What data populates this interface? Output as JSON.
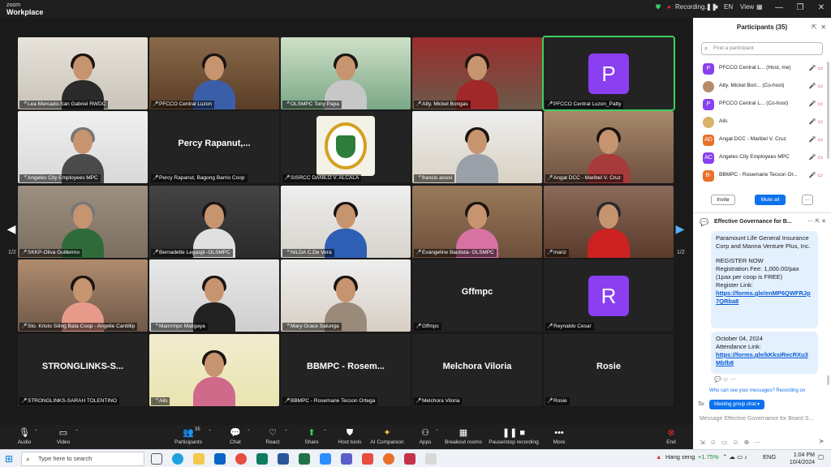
{
  "app": {
    "logo_line1": "zoom",
    "logo_line2": "Workplace",
    "recording_label": "Recording...",
    "language": "EN",
    "view_label": "View"
  },
  "video_grid": {
    "page_left": "1/2",
    "page_right": "1/2",
    "tiles": [
      {
        "name": "Lea Mercado-San Gabriel RWDC"
      },
      {
        "name": "PFCCO Central Luzon"
      },
      {
        "name": "OLSMPC Tony Papa"
      },
      {
        "name": "Atty. Mickel Bongas"
      },
      {
        "name": "PFCCO Central Luzon_Patty",
        "avatar": "P"
      },
      {
        "name": "Angeles City Employees MPC"
      },
      {
        "name": "Percy Rapanut, Bagong Barrio Coop",
        "big": "Percy Rapanut,..."
      },
      {
        "name": "SISRCC DANILO V. ALCALA"
      },
      {
        "name": "francis assisi"
      },
      {
        "name": "Angat DCC - Maribel V. Cruz"
      },
      {
        "name": "SKKP-Oliva Guillermo"
      },
      {
        "name": "Bernadette Legaspi -OLSMPC"
      },
      {
        "name": "NILDA C.De Vera"
      },
      {
        "name": "Evangeline Bautista- OLSMPC"
      },
      {
        "name": "mariz"
      },
      {
        "name": "Sto. Kristo Siling Bata Coop - Angelie Cantillip"
      },
      {
        "name": "Mamrmpc Maligaya"
      },
      {
        "name": "Mary Grace Salunga"
      },
      {
        "name": "Gffmpc",
        "big": "Gffmpc"
      },
      {
        "name": "Reynaldo Cesar",
        "avatar": "R"
      },
      {
        "name": "STRONGLINKS-SARAH TOLENTINO",
        "big": "STRONGLINKS-S..."
      },
      {
        "name": "Ails"
      },
      {
        "name": "BBMPC - Rosemarie Tecson Ortega",
        "big": "BBMPC - Rosem..."
      },
      {
        "name": "Melchora Viloria",
        "big": "Melchora Viloria"
      },
      {
        "name": "Rosie",
        "big": "Rosie"
      }
    ]
  },
  "participants_panel": {
    "title": "Participants (35)",
    "search_placeholder": "Find a participant",
    "items": [
      {
        "avatar": "P",
        "name": "PFCCO Central L... (Host, me)",
        "color": "#8a3ff0"
      },
      {
        "avatar": "",
        "name": "Atty. Mickel Bori... (Co-host)",
        "color": "#b78c6a"
      },
      {
        "avatar": "P",
        "name": "PFCCO Central L... (Co-host)",
        "color": "#8a3ff0"
      },
      {
        "avatar": "",
        "name": "Ails",
        "color": "#d8b26a"
      },
      {
        "avatar": "AD",
        "name": "Angat DCC - Maribel V. Cruz",
        "color": "#e8702a"
      },
      {
        "avatar": "AC",
        "name": "Angeles City Employees MPC",
        "color": "#8a3ff0"
      },
      {
        "avatar": "B-",
        "name": "BBMPC - Rosemarie Tecson Or...",
        "color": "#e8702a"
      }
    ],
    "invite_label": "Invite",
    "mute_all_label": "Mute all",
    "more_label": "..."
  },
  "chat_panel": {
    "title": "Effective Governance for B...",
    "msg1_text": "Paramount Life General Insurance Corp and Manna Venture Plus, Inc.",
    "msg1_reg": "REGISTER NOW",
    "msg1_fee": "Registration Fee: 1,000.00/pax (1pax per coop is FREE)",
    "msg1_link_label": "Register Link:",
    "msg1_link": "https://forms.gle/enMP6QWFRJp7QRba8",
    "msg2_date": "October 04, 2024",
    "msg2_link_label": "Attendance Link:",
    "msg2_link": "https://forms.gle/kKksiRecRXu3Mbfb8",
    "notice": "Who can see your messages? Recording on",
    "to_label": "To:",
    "to_value": "Meeting group chat",
    "input_placeholder": "Message Effective Governance for Board S..."
  },
  "toolbar": {
    "audio": "Audio",
    "video": "Video",
    "participants": "Participants",
    "participants_count": "35",
    "chat": "Chat",
    "react": "React",
    "share": "Share",
    "host_tools": "Host tools",
    "ai_companion": "AI Companion",
    "apps": "Apps",
    "breakout": "Breakout rooms",
    "pause_stop": "Pause/stop recording",
    "more": "More",
    "end": "End"
  },
  "taskbar": {
    "search_placeholder": "Type here to search",
    "stock_name": "Hang seng",
    "stock_change": "+1.75%",
    "language": "ENG",
    "time": "1:04 PM",
    "date": "10/4/2024"
  },
  "colors": {
    "accent": "#0e72ed",
    "active_speaker": "#3ccf5e",
    "muted": "#e02828",
    "avatar_purple": "#8a3ff0"
  }
}
